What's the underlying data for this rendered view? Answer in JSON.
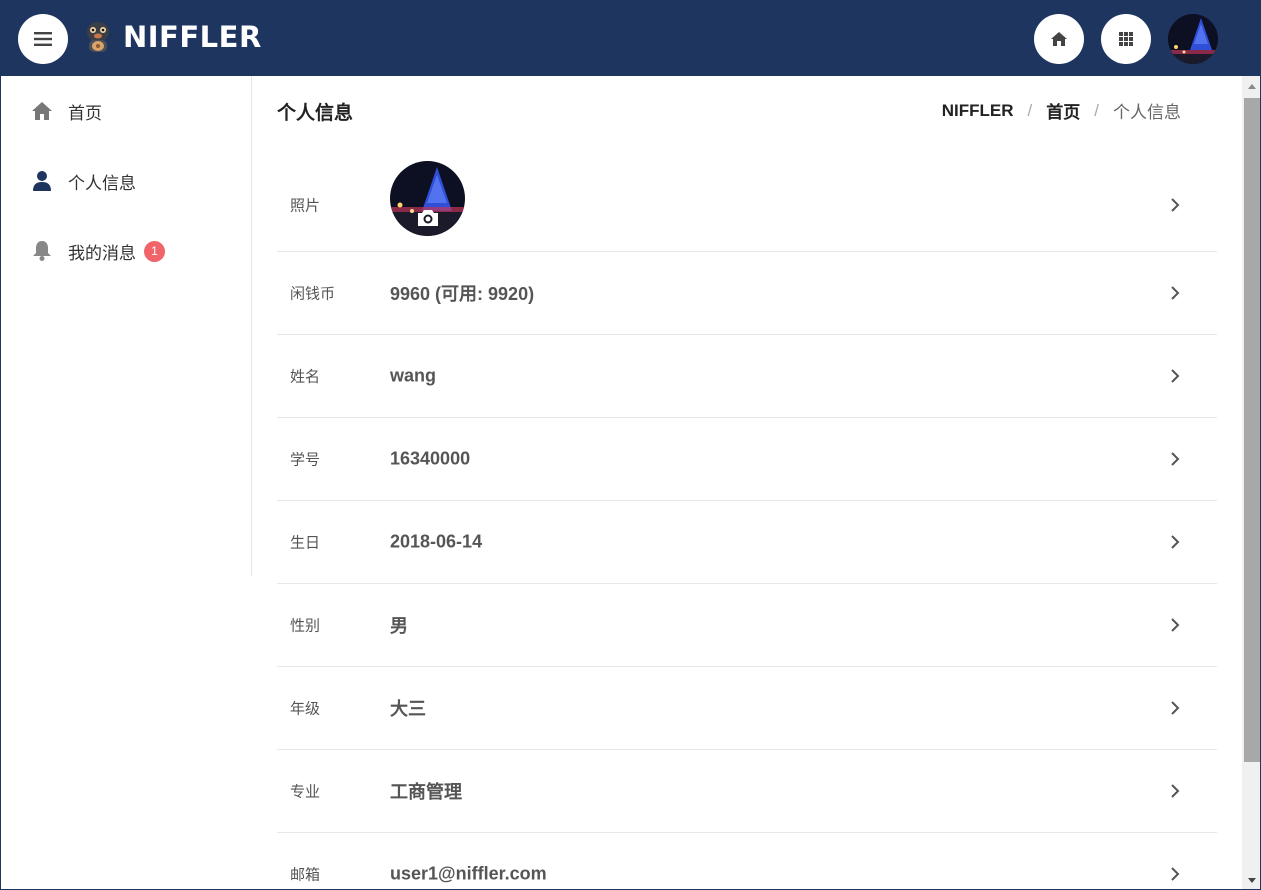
{
  "header": {
    "brand": "NIFFLER",
    "bar_color": "#1e3560",
    "icons": [
      "menu-icon",
      "mascot-logo",
      "home-icon",
      "apps-grid-icon",
      "user-avatar"
    ]
  },
  "sidebar": {
    "items": [
      {
        "label": "首页",
        "icon": "home-icon",
        "active": false
      },
      {
        "label": "个人信息",
        "icon": "user-icon",
        "active": true
      },
      {
        "label": "我的消息",
        "icon": "bell-icon",
        "active": false,
        "badge": "1"
      }
    ],
    "badge_color": "#f0646a"
  },
  "main": {
    "title": "个人信息",
    "breadcrumb": [
      "NIFFLER",
      "首页",
      "个人信息"
    ],
    "rows": [
      {
        "label": "照片",
        "value": ""
      },
      {
        "label": "闲钱币",
        "value": "9960 (可用: 9920)"
      },
      {
        "label": "姓名",
        "value": "wang"
      },
      {
        "label": "学号",
        "value": "16340000"
      },
      {
        "label": "生日",
        "value": "2018-06-14"
      },
      {
        "label": "性别",
        "value": "男"
      },
      {
        "label": "年级",
        "value": "大三"
      },
      {
        "label": "专业",
        "value": "工商管理"
      },
      {
        "label": "邮箱",
        "value": "user1@niffler.com"
      }
    ]
  }
}
